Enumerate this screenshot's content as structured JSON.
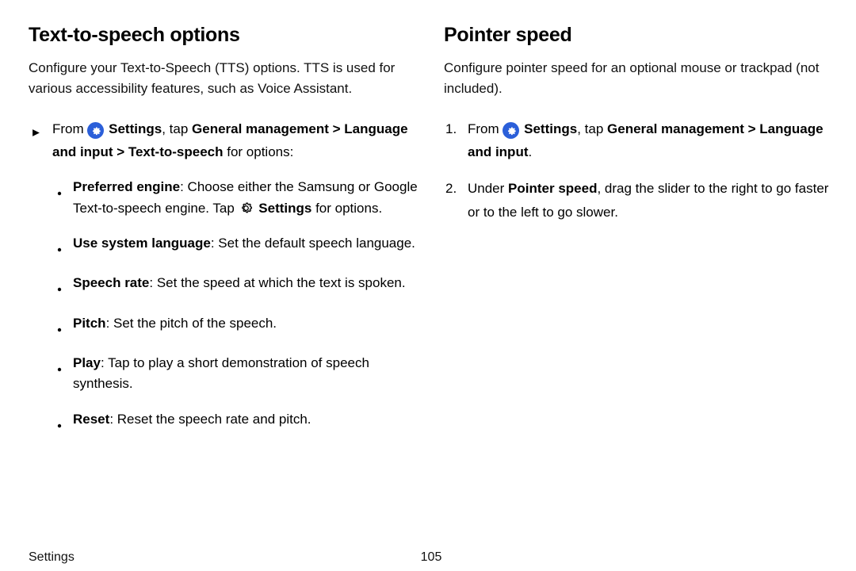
{
  "left": {
    "heading": "Text-to-speech options",
    "intro": "Configure your Text-to-Speech (TTS) options. TTS is used for various accessibility features, such as Voice Assistant.",
    "step_from": "From",
    "step_settings": " Settings",
    "step_tap": ", tap ",
    "step_path_bold1": "General management > Language and input > Text-to-speech",
    "step_for_options": " for options:",
    "bullets": {
      "b0_label": "Preferred engine",
      "b0_body1": ": Choose either the Samsung or Google Text-to-speech engine. Tap ",
      "b0_settings": " Settings",
      "b0_body2": " for options.",
      "b1_label": "Use system language",
      "b1_body": ": Set the default speech language.",
      "b2_label": "Speech rate",
      "b2_body": ": Set the speed at which the text is spoken.",
      "b3_label": "Pitch",
      "b3_body": ": Set the pitch of the speech.",
      "b4_label": "Play",
      "b4_body": ": Tap to play a short demonstration of speech synthesis.",
      "b5_label": "Reset",
      "b5_body": ": Reset the speech rate and pitch."
    }
  },
  "right": {
    "heading": "Pointer speed",
    "intro": "Configure pointer speed for an optional mouse or trackpad (not included).",
    "s1_num": "1.",
    "s1_from": "From",
    "s1_settings": " Settings",
    "s1_tap": ", tap ",
    "s1_path": "General management > Language and input",
    "s1_end": ".",
    "s2_num": "2.",
    "s2_pre": "Under ",
    "s2_bold": "Pointer speed",
    "s2_post": ", drag the slider to the right to go faster or to the left to go slower."
  },
  "footer": {
    "section": "Settings",
    "page": "105"
  }
}
